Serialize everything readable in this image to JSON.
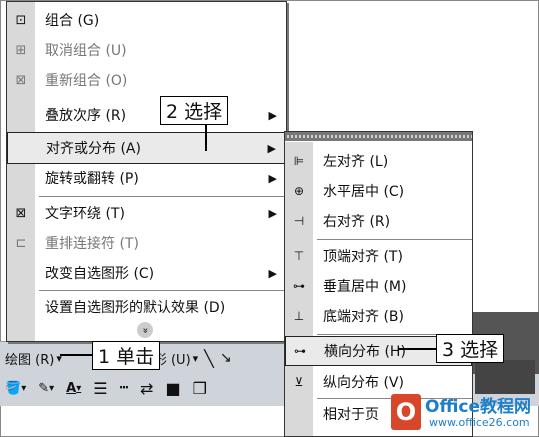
{
  "main_menu": {
    "items": [
      {
        "label": "组合 (G)",
        "icon": "group-icon",
        "disabled": false,
        "submenu": false
      },
      {
        "label": "取消组合 (U)",
        "icon": "ungroup-icon",
        "disabled": true,
        "submenu": false
      },
      {
        "label": "重新组合 (O)",
        "icon": "regroup-icon",
        "disabled": true,
        "submenu": false
      },
      {
        "label": "叠放次序 (R)",
        "icon": "",
        "disabled": false,
        "submenu": true
      },
      {
        "label": "对齐或分布 (A)",
        "icon": "",
        "disabled": false,
        "submenu": true,
        "highlighted": true
      },
      {
        "label": "旋转或翻转 (P)",
        "icon": "",
        "disabled": false,
        "submenu": true
      },
      {
        "label": "文字环绕 (T)",
        "icon": "text-wrap-icon",
        "disabled": false,
        "submenu": true
      },
      {
        "label": "重排连接符 (T)",
        "icon": "reroute-connector-icon",
        "disabled": true,
        "submenu": false
      },
      {
        "label": "改变自选图形 (C)",
        "icon": "",
        "disabled": false,
        "submenu": true
      },
      {
        "label": "设置自选图形的默认效果 (D)",
        "icon": "",
        "disabled": false,
        "submenu": false
      }
    ],
    "more_glyph": "»"
  },
  "sub_menu": {
    "items": [
      {
        "label": "左对齐 (L)",
        "icon": "align-left-icon"
      },
      {
        "label": "水平居中 (C)",
        "icon": "align-center-icon"
      },
      {
        "label": "右对齐 (R)",
        "icon": "align-right-icon"
      },
      {
        "label": "顶端对齐 (T)",
        "icon": "align-top-icon"
      },
      {
        "label": "垂直居中 (M)",
        "icon": "align-middle-icon"
      },
      {
        "label": "底端对齐 (B)",
        "icon": "align-bottom-icon"
      },
      {
        "label": "横向分布 (H)",
        "icon": "distribute-horizontal-icon",
        "highlighted": true
      },
      {
        "label": "纵向分布 (V)",
        "icon": "distribute-vertical-icon"
      },
      {
        "label": "相对于页",
        "icon": ""
      }
    ]
  },
  "toolbar": {
    "draw_label": "绘图 (R)",
    "autoshapes_label": "形 (U)",
    "dropdown": "▾"
  },
  "callouts": {
    "step1": "1 单击",
    "step2": "2 选择",
    "step3": "3 选择"
  },
  "watermark": {
    "logo": "O",
    "title": "Office教程网",
    "url": "www.office26.com"
  }
}
